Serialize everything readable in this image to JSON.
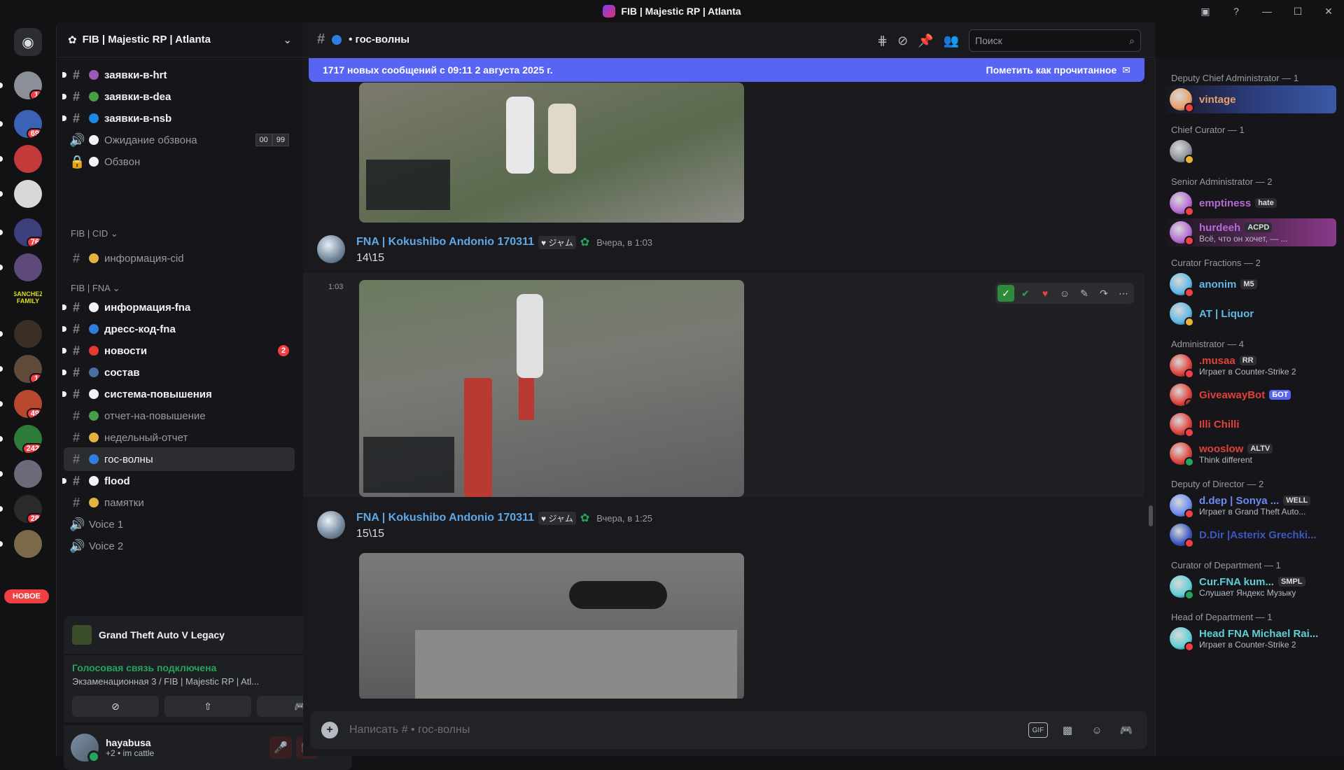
{
  "window": {
    "title": "FIB | Majestic RP | Atlanta",
    "buttons": [
      "minimize",
      "maximize",
      "close"
    ]
  },
  "guilds": [
    {
      "badge": "1",
      "color": "#8a8f98"
    },
    {
      "badge": "69",
      "color": "#3a62b5"
    },
    {
      "badge": "",
      "color": "#c23a3a"
    },
    {
      "badge": "",
      "color": "#d8d8d8"
    },
    {
      "badge": "76",
      "color": "#3b3f7a"
    },
    {
      "badge": "",
      "color": "#5e4a7a"
    },
    {
      "badge": "",
      "color": "#1a3a1a"
    },
    {
      "badge": "",
      "color": "#3a2e26"
    },
    {
      "badge": "1",
      "color": "#604a3a"
    },
    {
      "badge": "49",
      "color": "#b8492e"
    },
    {
      "badge": "242",
      "color": "#2e7a3a"
    },
    {
      "badge": "",
      "color": "#6a6a7a"
    },
    {
      "badge": "28",
      "color": "#2a2a2a"
    },
    {
      "badge": "",
      "color": "#7a6a4a"
    }
  ],
  "guild_label_sanchez": "SANCHEZ FAMILY",
  "new_label": "НОВОЕ",
  "server": {
    "name": "FIB | Majestic RP | Atlanta"
  },
  "channels": [
    {
      "name": "заявки-в-hrt",
      "type": "text",
      "unread": true,
      "emoji_color": "#9b59b6"
    },
    {
      "name": "заявки-в-dea",
      "type": "text",
      "unread": true,
      "emoji_color": "#43a047"
    },
    {
      "name": "заявки-в-nsb",
      "type": "text",
      "unread": true,
      "emoji_color": "#1e88e5"
    },
    {
      "name": "Ожидание обзвона",
      "type": "stage",
      "unread": false,
      "emoji_color": "#f2f3f5",
      "counts": [
        "00",
        "99"
      ]
    },
    {
      "name": "Обзвон",
      "type": "locked",
      "unread": false,
      "emoji_color": "#f2f3f5"
    }
  ],
  "category_cid": "FIB | CID",
  "channels_cid": [
    {
      "name": "информация-cid",
      "type": "text",
      "unread": false,
      "emoji_color": "#e3b341"
    }
  ],
  "category_fna": "FIB | FNA",
  "channels_fna": [
    {
      "name": "информация-fna",
      "type": "text",
      "unread": true,
      "emoji_color": "#f2f3f5"
    },
    {
      "name": "дресс-код-fna",
      "type": "text",
      "unread": true,
      "emoji_color": "#2f7de1"
    },
    {
      "name": "новости",
      "type": "text",
      "unread": true,
      "emoji_color": "#e53935",
      "badge": "2"
    },
    {
      "name": "состав",
      "type": "text",
      "unread": true,
      "emoji_color": "#4a6fa5"
    },
    {
      "name": "система-повышения",
      "type": "text",
      "unread": true,
      "emoji_color": "#f2f3f5"
    },
    {
      "name": "отчет-на-повышение",
      "type": "text",
      "unread": false,
      "emoji_color": "#43a047"
    },
    {
      "name": "недельный-отчет",
      "type": "text",
      "unread": false,
      "emoji_color": "#e3b341"
    },
    {
      "name": "гос-волны",
      "type": "text",
      "unread": false,
      "selected": true,
      "emoji_color": "#2f7de1"
    },
    {
      "name": "flood",
      "type": "text",
      "unread": true,
      "emoji_color": "#f2f3f5"
    },
    {
      "name": "памятки",
      "type": "text",
      "unread": false,
      "emoji_color": "#e3b341"
    },
    {
      "name": "Voice 1",
      "type": "voice",
      "unread": false
    },
    {
      "name": "Voice 2",
      "type": "voice",
      "unread": false
    }
  ],
  "activity": {
    "game": "Grand Theft Auto V Legacy"
  },
  "voice": {
    "status": "Голосовая связь подключена",
    "channel": "Экзаменационная 3 / FIB | Majestic RP | Atl..."
  },
  "user": {
    "name": "hayabusa",
    "status": "+2 • im cattle"
  },
  "chat": {
    "channel": "гос-волны",
    "search_placeholder": "Поиск",
    "new_messages": "1717 новых сообщений с 09:11 2 августа 2025 г.",
    "mark_read": "Пометить как прочитанное",
    "composer_placeholder": "Написать #  • гос-волны",
    "messages": [
      {
        "author": "FNA | Kokushibo Andonio 170311",
        "tag": "ジャム",
        "time": "Вчера, в 1:03",
        "text": "14\\15",
        "side_time": "1:03"
      },
      {
        "author": "FNA | Kokushibo Andonio 170311",
        "tag": "ジャム",
        "time": "Вчера, в 1:25",
        "text": "15\\15"
      }
    ]
  },
  "members": {
    "roles": [
      {
        "name": "Deputy Chief Administrator — 1",
        "members": [
          {
            "name": "vintage",
            "color": "#e8a06a",
            "status": "#f23f43"
          }
        ]
      },
      {
        "name": "Chief Curator — 1",
        "members": [
          {
            "name": "",
            "color": "#8a8f98",
            "status": "#f0b232"
          }
        ]
      },
      {
        "name": "Senior Administrator — 2",
        "members": [
          {
            "name": "emptiness",
            "badge": "hate",
            "color": "#b56ad6",
            "status": "#f23f43"
          },
          {
            "name": "hurdeeh",
            "badge": "ACPD",
            "sub": "Всё, что он хочет, — ...",
            "color": "#b56ad6",
            "status": "#f23f43"
          }
        ]
      },
      {
        "name": "Curator Fractions — 2",
        "members": [
          {
            "name": "anonim",
            "badge": "M5",
            "color": "#5fb8e6",
            "status": "#f23f43"
          },
          {
            "name": "AT | Liquor",
            "color": "#5fb8e6",
            "status": "#f0b232"
          }
        ]
      },
      {
        "name": "Administrator — 4",
        "members": [
          {
            "name": ".musaa",
            "badge": "RR",
            "sub": "Играет в Counter-Strike 2",
            "color": "#e0413a",
            "status": "#f23f43"
          },
          {
            "name": "GiveawayBot",
            "badge": "БОТ",
            "color": "#e0413a",
            "status": ""
          },
          {
            "name": "Illi Chilli",
            "color": "#e0413a",
            "status": "#f23f43"
          },
          {
            "name": "wooslow",
            "badge": "ALTV",
            "sub": "Think different",
            "color": "#e0413a",
            "status": "#23a55a"
          }
        ]
      },
      {
        "name": "Deputy of Director — 2",
        "members": [
          {
            "name": "d.dep | Sonya ...",
            "badge": "WELL",
            "sub": "Играет в Grand Theft Auto...",
            "color": "#6a8cf2",
            "status": "#f23f43"
          },
          {
            "name": "D.Dir |Asterix Grechki...",
            "color": "#3a58c2",
            "status": "#f23f43"
          }
        ]
      },
      {
        "name": "Curator of Department — 1",
        "members": [
          {
            "name": "Cur.FNA kum...",
            "badge": "SMPL",
            "sub": "Слушает Яндекс Музыку",
            "color": "#5fcfd6",
            "status": "#23a55a"
          }
        ]
      },
      {
        "name": "Head of Department — 1",
        "members": [
          {
            "name": "Head FNA Michael Rai...",
            "sub": "Играет в Counter-Strike 2",
            "color": "#5fcfd6",
            "status": "#f23f43"
          }
        ]
      }
    ]
  }
}
